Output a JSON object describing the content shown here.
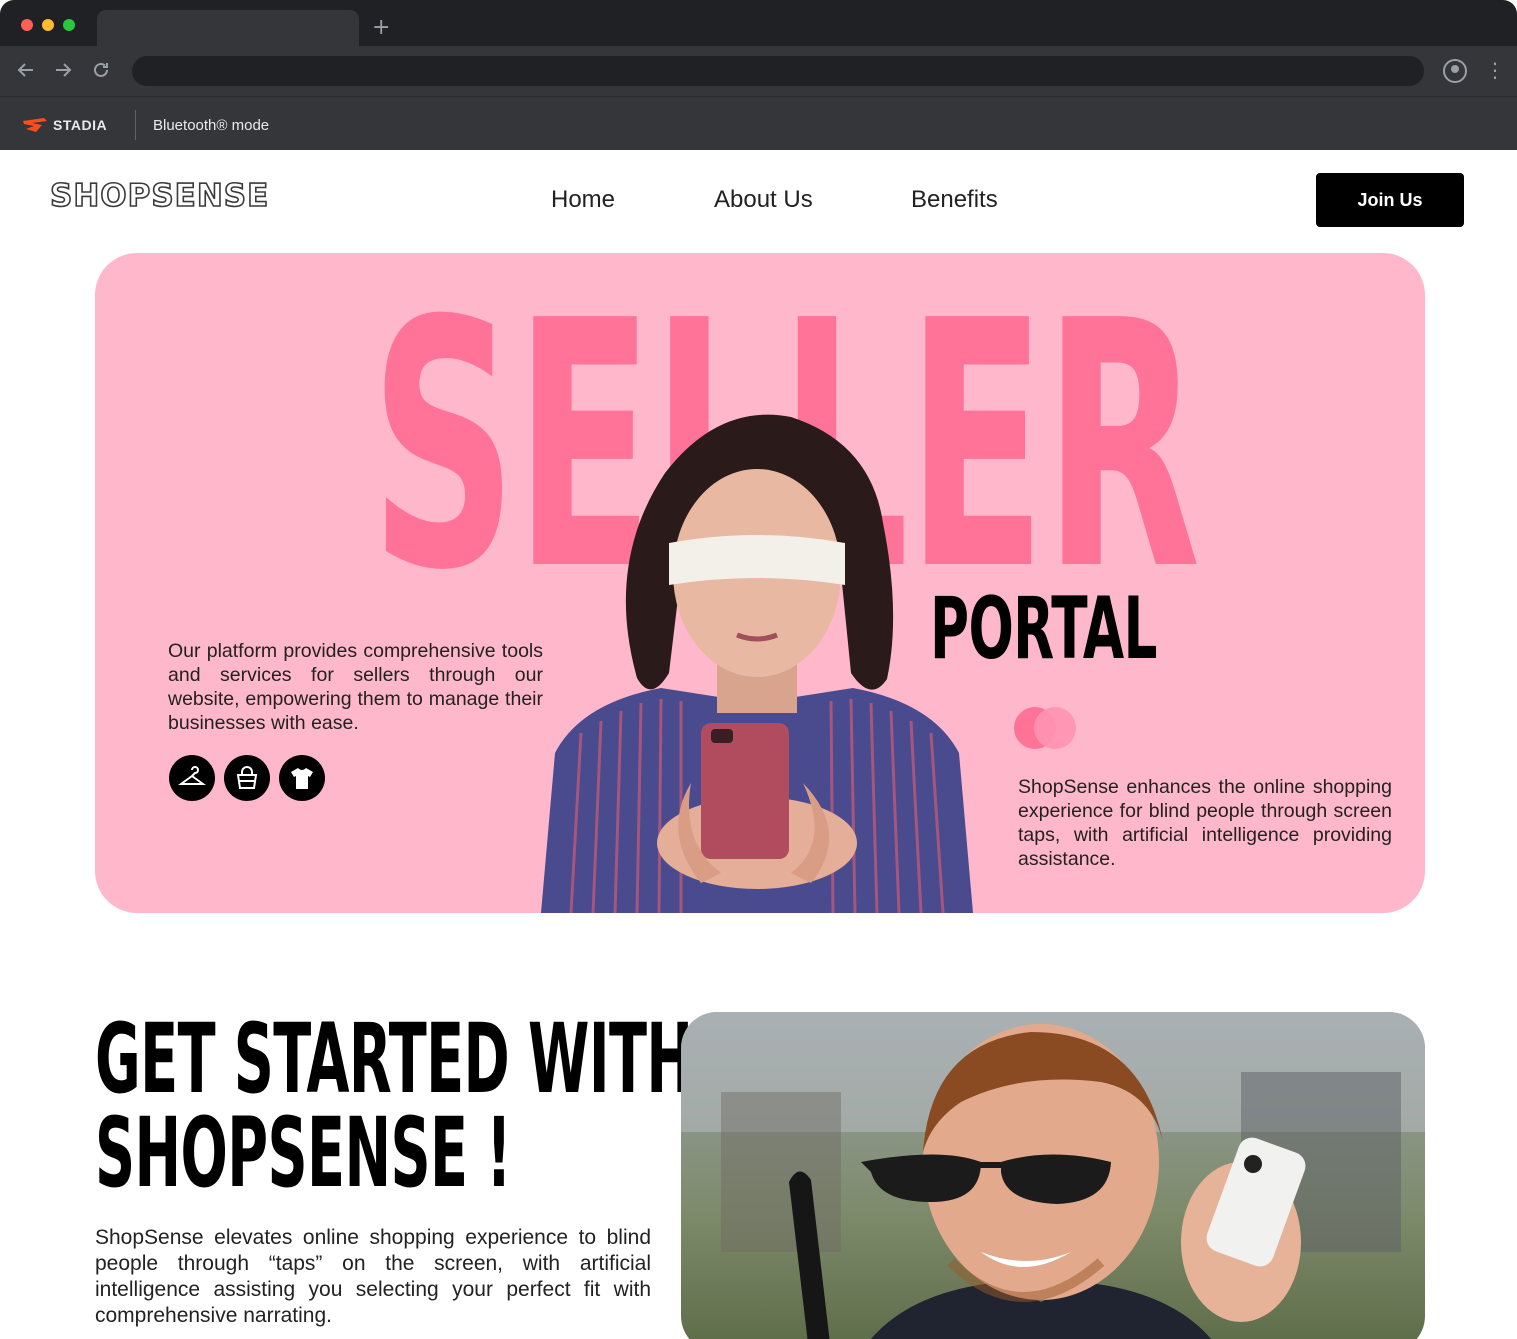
{
  "browser": {
    "new_tab_symbol": "+",
    "back_icon": "arrow-left-icon",
    "forward_icon": "arrow-right-icon",
    "reload_icon": "reload-icon",
    "bookmarks": {
      "stadia_label": "STADIA",
      "bluetooth_label": "Bluetooth® mode"
    }
  },
  "nav": {
    "logo": "SHOPSENSE",
    "links": [
      "Home",
      "About Us",
      "Benefits"
    ],
    "cta_label": "Join Us"
  },
  "hero": {
    "headline": "SELLER",
    "subheadline": "PORTAL",
    "left_text": "Our platform provides comprehensive tools and services for sellers through our website, empowering them to manage their businesses with ease.",
    "category_icons": [
      "hanger-icon",
      "bag-icon",
      "tshirt-icon"
    ],
    "right_text": "ShopSense enhances the online shopping experience for blind people through screen taps, with artificial intelligence providing assistance."
  },
  "get_started": {
    "title_line1": "GET STARTED WITH",
    "title_line2": "SHOPSENSE !",
    "text": "ShopSense elevates online shopping experience to blind people through “taps” on the screen, with artificial intelligence assisting you selecting your perfect fit with comprehensive narrating."
  },
  "colors": {
    "hero_background": "#ffb8cb",
    "accent_pink": "#ff7399",
    "chrome_dark": "#202124",
    "button_black": "#000000"
  }
}
